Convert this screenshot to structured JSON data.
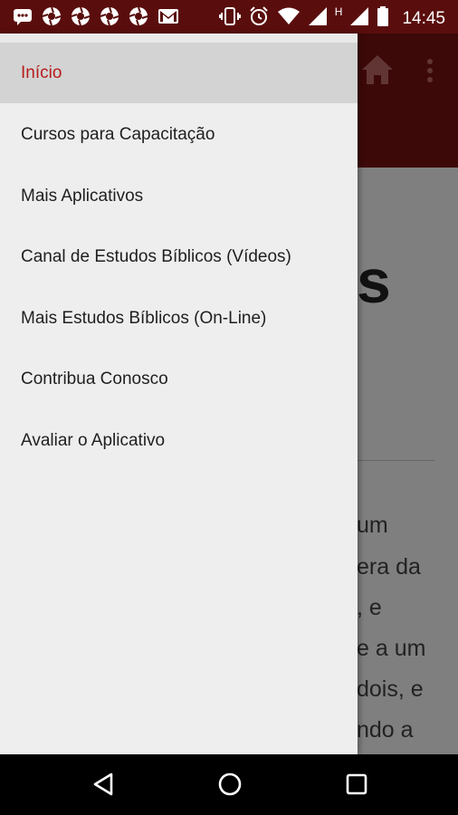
{
  "status_bar": {
    "time": "14:45",
    "network_label": "H",
    "left_icons": [
      "message-icon",
      "aperture-icon",
      "aperture-icon",
      "aperture-icon",
      "aperture-icon",
      "gmail-icon"
    ],
    "right_icons": [
      "vibrate-icon",
      "alarm-icon",
      "wifi-icon",
      "signal-icon",
      "signal-icon",
      "battery-icon"
    ]
  },
  "drawer": {
    "items": [
      {
        "label": "Início",
        "active": true
      },
      {
        "label": "Cursos para Capacitação",
        "active": false
      },
      {
        "label": "Mais Aplicativos",
        "active": false
      },
      {
        "label": "Canal de Estudos Bíblicos (Vídeos)",
        "active": false
      },
      {
        "label": "Mais Estudos Bíblicos (On-Line)",
        "active": false
      },
      {
        "label": "Contribua Conosco",
        "active": false
      },
      {
        "label": "Avaliar o Aplicativo",
        "active": false
      }
    ]
  },
  "background": {
    "heading_fragment": "s",
    "text_fragments": [
      "um",
      "era da",
      ", e",
      "e a um",
      "dois, e",
      "ndo a"
    ]
  },
  "colors": {
    "status_bar": "#5a0d0d",
    "app_header": "#7b1010",
    "active_text": "#b71c1c",
    "drawer_bg": "#eeeeee"
  },
  "nav_bar": {
    "buttons": [
      "back-icon",
      "home-icon",
      "recents-icon"
    ]
  }
}
